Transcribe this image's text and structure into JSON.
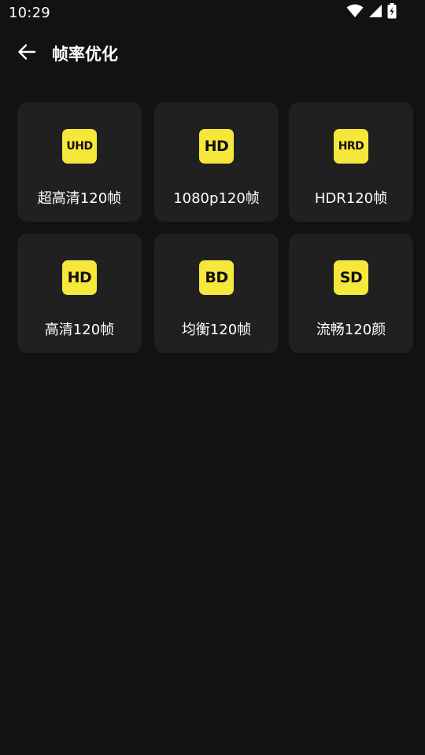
{
  "status_bar": {
    "time": "10:29",
    "icons": [
      "wifi-icon",
      "signal-icon",
      "battery-charging-icon"
    ]
  },
  "app_bar": {
    "back_icon": "arrow-left-icon",
    "title": "帧率优化"
  },
  "colors": {
    "background": "#121212",
    "card": "#202020",
    "badge": "#f6e73b",
    "badge_text": "#111111",
    "text": "#ffffff"
  },
  "options": [
    {
      "badge": "UHD",
      "label": "超高清120帧"
    },
    {
      "badge": "HD",
      "label": "1080p120帧"
    },
    {
      "badge": "HRD",
      "label": "HDR120帧"
    },
    {
      "badge": "HD",
      "label": "高清120帧"
    },
    {
      "badge": "BD",
      "label": "均衡120帧"
    },
    {
      "badge": "SD",
      "label": "流畅120颜"
    }
  ]
}
